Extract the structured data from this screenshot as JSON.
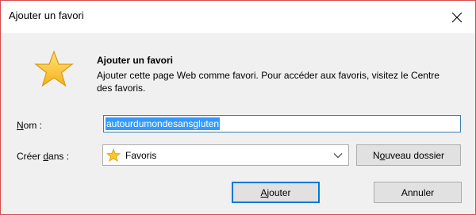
{
  "dialog": {
    "title": "Ajouter un favori",
    "heading": "Ajouter un favori",
    "description": "Ajouter cette page Web comme favori. Pour accéder aux favoris, visitez le Centre des favoris."
  },
  "form": {
    "name_label_accesskey": "N",
    "name_label_rest": "om :",
    "name_value": "autourdumondesansgluten",
    "create_in_label_before": "Créer ",
    "create_in_label_accesskey": "d",
    "create_in_label_after": "ans :",
    "folder_value": "Favoris"
  },
  "buttons": {
    "new_folder_accesskey": "o",
    "new_folder_before": "N",
    "new_folder_after": "uveau dossier",
    "add_accesskey": "A",
    "add_rest": "jouter",
    "cancel": "Annuler"
  },
  "icons": {
    "close": "close-icon",
    "favorites_star": "star-icon",
    "folder_star": "star-icon",
    "dropdown": "chevron-down-icon"
  },
  "colors": {
    "selection": "#3399ff",
    "focus_border": "#0078d7",
    "star_fill": "#fcc62d"
  }
}
